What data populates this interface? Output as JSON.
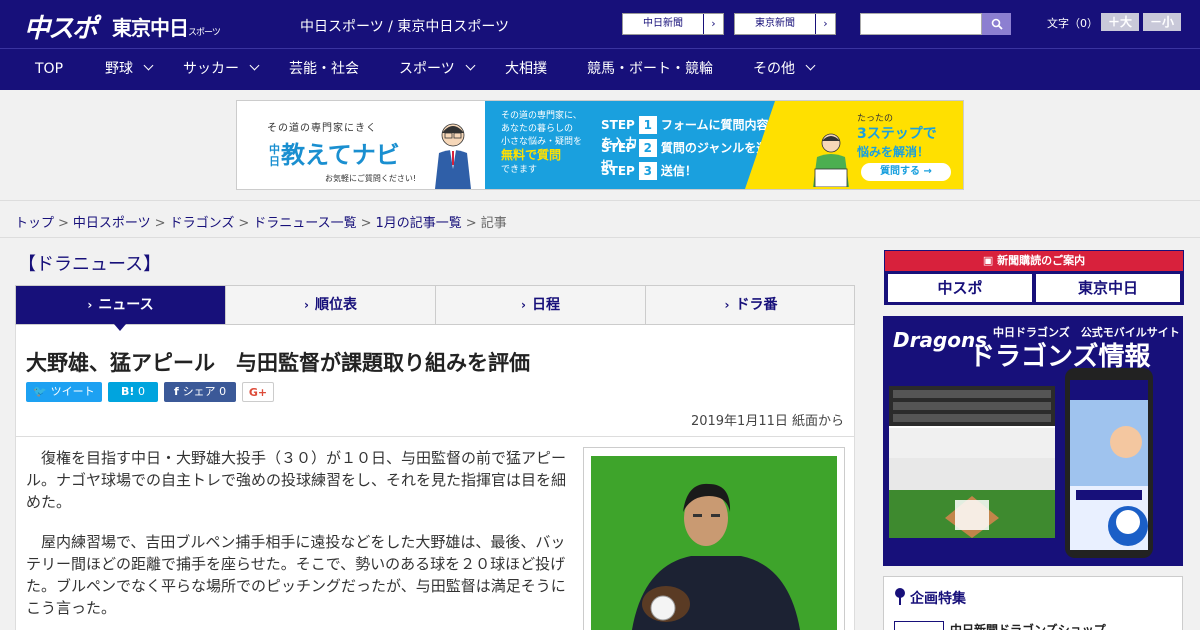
{
  "header": {
    "logo_main": "中スポ",
    "logo_tokyo": "東京中日",
    "logo_tokyo_small": "スポーツ",
    "site_title": "中日スポーツ / 東京中日スポーツ",
    "links": [
      {
        "label": "中日新聞"
      },
      {
        "label": "東京新聞"
      }
    ],
    "search_placeholder": "",
    "font_size_label": "文字（0）",
    "font_larger": "＋大",
    "font_smaller": "－小"
  },
  "nav": {
    "items": [
      {
        "label": "TOP",
        "dropdown": false
      },
      {
        "label": "野球",
        "dropdown": true
      },
      {
        "label": "サッカー",
        "dropdown": true
      },
      {
        "label": "芸能・社会",
        "dropdown": false
      },
      {
        "label": "スポーツ",
        "dropdown": true
      },
      {
        "label": "大相撲",
        "dropdown": false
      },
      {
        "label": "競馬・ボート・競輪",
        "dropdown": false
      },
      {
        "label": "その他",
        "dropdown": true
      }
    ]
  },
  "ad": {
    "sub": "その道の専門家にきく",
    "brand_prefix": "中日",
    "brand": "教えてナビ",
    "note": "お気軽にご質問ください!",
    "mid_lines": [
      "その道の専門家に、",
      "あなたの暮らしの",
      "小さな悩み・疑問を"
    ],
    "mid_highlight": "無料で質問",
    "mid_tail": "できます",
    "steps": [
      {
        "num": "1",
        "text": "フォームに質問内容を入力"
      },
      {
        "num": "2",
        "text": "質問のジャンルを選択"
      },
      {
        "num": "3",
        "text": "送信！"
      }
    ],
    "step_label": "STEP",
    "right_t1": "たったの",
    "right_t2": "3ステップで",
    "right_t3": "悩みを解消！",
    "cta": "質問する →"
  },
  "breadcrumb": {
    "items": [
      "トップ",
      "中日スポーツ",
      "ドラゴンズ",
      "ドラニュース一覧",
      "1月の記事一覧"
    ],
    "current": "記事"
  },
  "section_title": "【ドラニュース】",
  "tabs": [
    {
      "label": "ニュース",
      "active": true
    },
    {
      "label": "順位表",
      "active": false
    },
    {
      "label": "日程",
      "active": false
    },
    {
      "label": "ドラ番",
      "active": false
    }
  ],
  "article": {
    "headline": "大野雄、猛アピール　与田監督が課題取り組みを評価",
    "share": {
      "tweet": "ツイート",
      "hatena": "B!",
      "hatena_count": "0",
      "fb": "シェア",
      "fb_count": "0",
      "gplus": "G+"
    },
    "dateline": "2019年1月11日 紙面から",
    "paragraphs": [
      "復権を目指す中日・大野雄大投手（３０）が１０日、与田監督の前で猛アピール。ナゴヤ球場での自主トレで強めの投球練習をし、それを見た指揮官は目を細めた。",
      "屋内練習場で、吉田ブルペン捕手相手に遠投などをした大野雄は、最後、バッテリー間ほどの距離で捕手を座らせた。そこで、勢いのある球を２０球ほど投げた。ブルペンでなく平らな場所でのピッチングだったが、与田監督は満足そうにこう言った。"
    ]
  },
  "sidebar": {
    "subscribe_head": "新聞購読のご案内",
    "subscribe_logos": [
      "中スポ",
      "東京中日"
    ],
    "dragons_brand": "Dragons",
    "dragons_t1": "中日ドラゴンズ　公式モバイルサイト",
    "dragons_t2": "ドラゴンズ情報",
    "plan_title": "企画特集",
    "plan_item": "中日新聞ドラゴンズショップ"
  },
  "colors": {
    "brand_navy": "#17107a",
    "accent_red": "#d8213c",
    "ad_blue": "#1aa0de",
    "ad_yellow": "#ffe000"
  }
}
